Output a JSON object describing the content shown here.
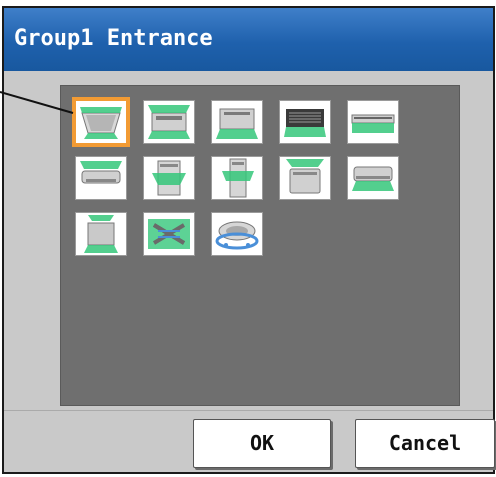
{
  "dialog": {
    "title": "Group1 Entrance",
    "ok_label": "OK",
    "cancel_label": "Cancel"
  },
  "colors": {
    "title_bar": "#1f61ad",
    "panel": "#6f6f6f",
    "selection": "#f29b34",
    "airflow": "#35c77a"
  },
  "icons": [
    {
      "name": "4-way-cassette-icon",
      "selected": true
    },
    {
      "name": "ceiling-cassette-icon",
      "selected": false
    },
    {
      "name": "1-way-cassette-icon",
      "selected": false
    },
    {
      "name": "ceiling-concealed-duct-icon",
      "selected": false
    },
    {
      "name": "ceiling-concealed-slim-icon",
      "selected": false
    },
    {
      "name": "ceiling-suspended-icon",
      "selected": false
    },
    {
      "name": "floor-standing-icon",
      "selected": false
    },
    {
      "name": "floor-standing-tall-icon",
      "selected": false
    },
    {
      "name": "floor-console-icon",
      "selected": false
    },
    {
      "name": "wall-mounted-icon",
      "selected": false
    },
    {
      "name": "floor-concealed-icon",
      "selected": false
    },
    {
      "name": "heat-exchanger-ventilation-icon",
      "selected": false
    },
    {
      "name": "round-flow-cassette-icon",
      "selected": false
    }
  ]
}
